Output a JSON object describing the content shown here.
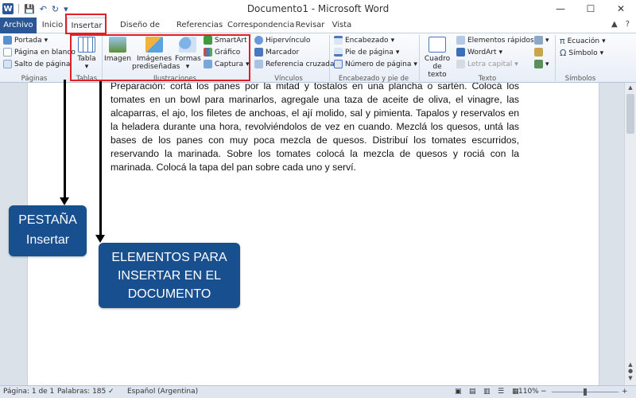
{
  "window": {
    "app_letter": "W",
    "title": "Documento1  -  Microsoft Word",
    "minimize": "—",
    "maximize": "☐",
    "close": "✕"
  },
  "tabs": [
    "Archivo",
    "Inicio",
    "Insertar",
    "Diseño de página",
    "Referencias",
    "Correspondencia",
    "Revisar",
    "Vista"
  ],
  "ribbon": {
    "paginas": {
      "items": [
        "Portada",
        "Página en blanco",
        "Salto de página"
      ],
      "label": "Páginas"
    },
    "tablas": {
      "button": "Tabla",
      "label": "Tablas"
    },
    "ilustraciones": {
      "imagen": "Imagen",
      "imagenes_line1": "Imágenes",
      "imagenes_line2": "prediseñadas",
      "formas": "Formas",
      "smartart": "SmartArt",
      "grafico": "Gráfico",
      "captura": "Captura",
      "label": "Ilustraciones"
    },
    "vinculos": {
      "items": [
        "Hipervínculo",
        "Marcador",
        "Referencia cruzada"
      ],
      "label": "Vínculos"
    },
    "encabezado": {
      "items": [
        "Encabezado",
        "Pie de página",
        "Número de página"
      ],
      "label": "Encabezado y pie de página"
    },
    "texto": {
      "cuadro_line1": "Cuadro",
      "cuadro_line2": "de texto",
      "items": [
        "Elementos rápidos",
        "WordArt",
        "Letra capital"
      ],
      "label": "Texto"
    },
    "simbolos": {
      "items": [
        "Ecuación",
        "Símbolo"
      ],
      "label": "Símbolos"
    }
  },
  "document": {
    "paragraph": "Preparación: cortá los panes por la mitad y tostalos en una plancha o sartén. Colocá los tomates en un bowl para marinarlos, agregale una taza de aceite de oliva, el vinagre, las alcaparras, el ajo, los filetes de anchoas, el ají molido, sal y pimienta. Tapalos y reservalos en la heladera durante una hora, revolviéndolos de vez en cuando. Mezclá los quesos, untá las bases de los panes con muy poca mezcla de quesos. Distribuí los tomates escurridos, reservando la marinada. Sobre los tomates colocá la mezcla de quesos y rociá con la marinada. Colocá la tapa del pan sobre cada uno y serví."
  },
  "status": {
    "page": "Página: 1 de 1",
    "words": "Palabras: 185",
    "language": "Español (Argentina)",
    "zoom": "110%",
    "zoom_minus": "−",
    "zoom_plus": "+"
  },
  "annotations": {
    "tab_line1": "PESTAÑA",
    "tab_line2": "Insertar",
    "elem_line1": "ELEMENTOS PARA",
    "elem_line2": "INSERTAR EN EL",
    "elem_line3": "DOCUMENTO"
  },
  "colors": {
    "file_tab": "#2b5797",
    "highlight_border": "#e21f26",
    "callout_bg": "#174f8f"
  }
}
